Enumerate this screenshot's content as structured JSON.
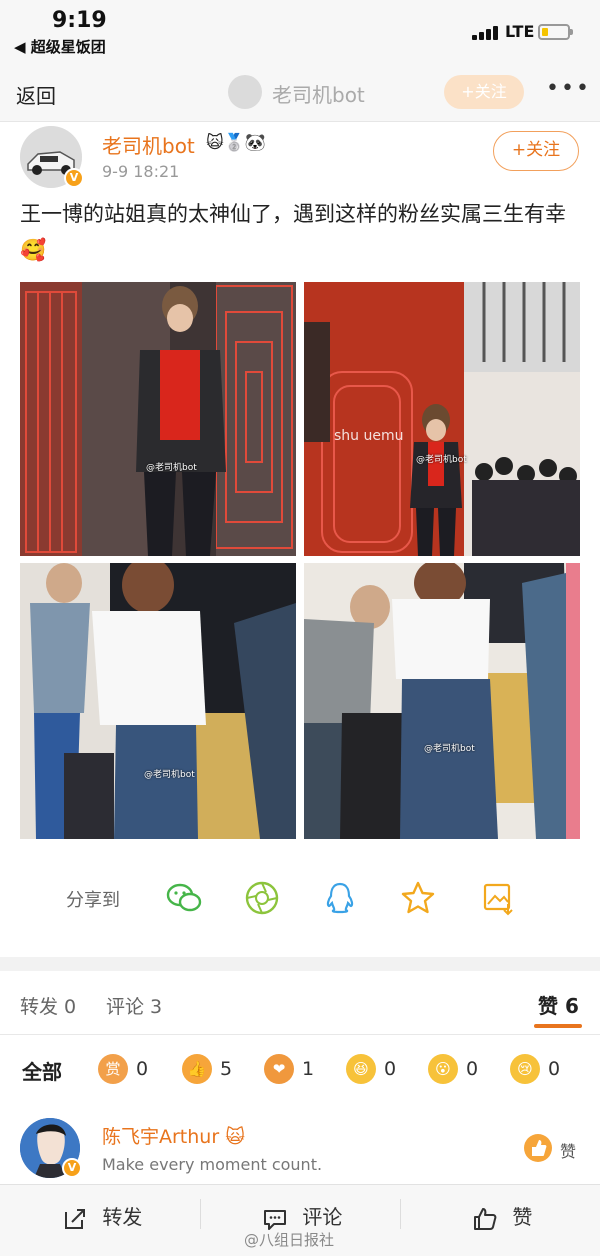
{
  "status_bar": {
    "time": "9:19",
    "back_app": "◀ 超级星饭团",
    "network": "LTE",
    "battery_level": 0.25
  },
  "navbar": {
    "back_label": "返回",
    "title": "老司机bot",
    "follow_label": "+关注",
    "more_label": "•••"
  },
  "post": {
    "author": "老司机bot",
    "badges": "🙀🥈🐼",
    "time": "9-9 18:21",
    "follow_label": "+关注",
    "text": "王一博的站姐真的太神仙了，遇到这样的粉丝实属三生有幸🥰",
    "watermark": "@老司机bot",
    "photo2_sign": "shu uemu"
  },
  "share": {
    "label": "分享到",
    "targets": [
      "wechat-icon",
      "moments-icon",
      "qq-icon",
      "favorite-icon",
      "save-image-icon"
    ]
  },
  "counts": {
    "repost": "转发 0",
    "comment": "评论 3",
    "like": "赞 6"
  },
  "reactions": {
    "all_label": "全部",
    "items": [
      {
        "icon": "reward-icon",
        "glyph": "赏",
        "count": "0"
      },
      {
        "icon": "thumbs-up-icon",
        "glyph": "👍",
        "count": "5"
      },
      {
        "icon": "heart-icon",
        "glyph": "❤",
        "count": "1"
      },
      {
        "icon": "laugh-icon",
        "glyph": "😆",
        "count": "0"
      },
      {
        "icon": "wow-icon",
        "glyph": "😮",
        "count": "0"
      },
      {
        "icon": "sad-icon",
        "glyph": "😢",
        "count": "0"
      }
    ]
  },
  "comment": {
    "name": "陈飞宇Arthur",
    "badge": "🙀",
    "text": "Make every moment count.",
    "like_label": "赞"
  },
  "bottom_bar": {
    "repost": "转发",
    "comment": "评论",
    "like": "赞",
    "watermark": "@八组日报社"
  },
  "colors": {
    "accent": "#e8741d",
    "link": "#e8741d"
  }
}
